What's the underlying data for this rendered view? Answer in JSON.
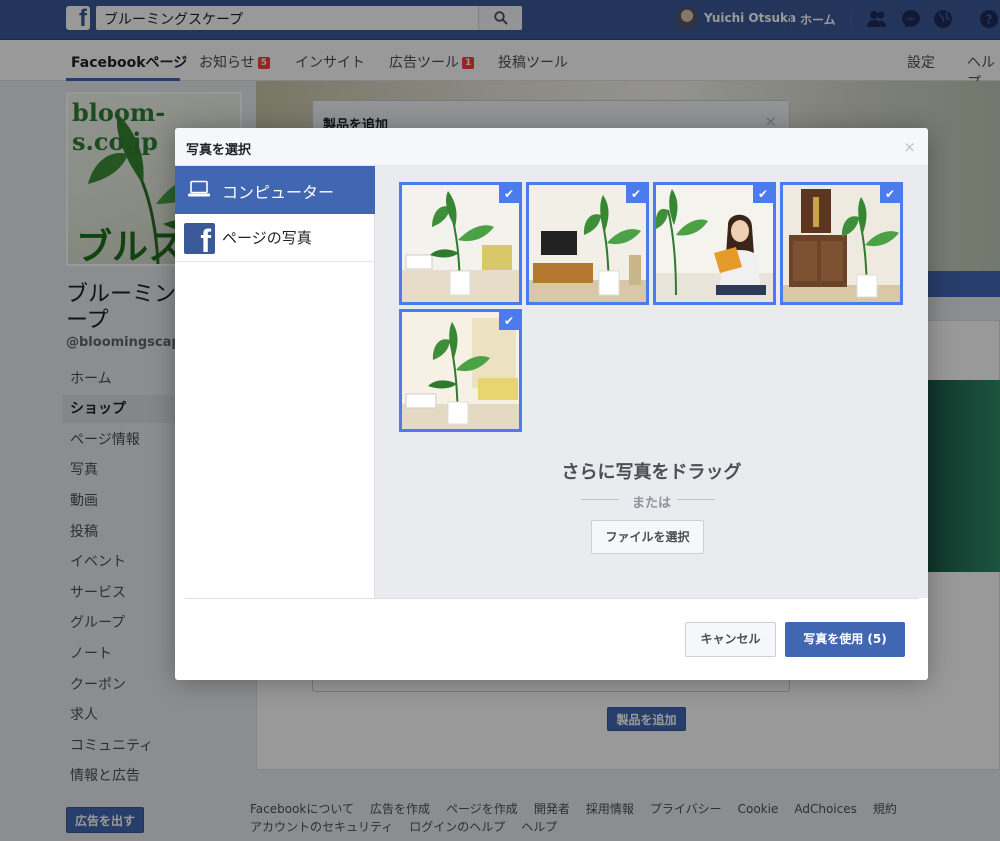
{
  "topbar": {
    "search_value": "ブルーミングスケープ",
    "user_name": "Yuichi Otsuka",
    "home_label": "ホーム"
  },
  "page_tabs": [
    {
      "label": "Facebookページ",
      "badge": ""
    },
    {
      "label": "お知らせ",
      "badge": "5"
    },
    {
      "label": "インサイト",
      "badge": ""
    },
    {
      "label": "広告ツール",
      "badge": "1"
    },
    {
      "label": "投稿ツール",
      "badge": ""
    },
    {
      "label": "設定",
      "badge": ""
    },
    {
      "label": "ヘルプ",
      "badge": ""
    }
  ],
  "left": {
    "profile_brand": "bloom-s.co.jp",
    "profile_jp": "ブルス",
    "page_name": "ブルーミングスケープ",
    "handle": "@bloomingscape",
    "nav": [
      "ホーム",
      "ショップ",
      "ページ情報",
      "写真",
      "動画",
      "投稿",
      "イベント",
      "サービス",
      "グループ",
      "ノート",
      "クーポン",
      "求人",
      "コミュニティ",
      "情報と広告"
    ],
    "active_nav": "ショップ",
    "ad_button": "広告を出す"
  },
  "product_dialog": {
    "title": "製品を追加",
    "add_button": "製品を追加"
  },
  "footer": {
    "links": [
      "Facebookについて",
      "広告を作成",
      "ページを作成",
      "開発者",
      "採用情報",
      "プライバシー",
      "Cookie",
      "AdChoices",
      "規約",
      "アカウントのセキュリティ",
      "ログインのヘルプ",
      "ヘルプ"
    ]
  },
  "dialog": {
    "title": "写真を選択",
    "close": "×",
    "sidebar": [
      {
        "label": "コンピューター",
        "icon": "laptop-icon"
      },
      {
        "label": "ページの写真",
        "icon": "facebook-icon"
      }
    ],
    "photos": [
      {
        "selected": true,
        "subject": "plant-living-room"
      },
      {
        "selected": true,
        "subject": "plant-tv-room"
      },
      {
        "selected": true,
        "subject": "woman-reading"
      },
      {
        "selected": true,
        "subject": "plant-cabinet"
      },
      {
        "selected": true,
        "subject": "plant-sofa"
      }
    ],
    "check_glyph": "✔",
    "drag_title": "さらに写真をドラッグ",
    "or_text": "または",
    "file_button": "ファイルを選択",
    "cancel_button": "キャンセル",
    "use_button": "写真を使用 (5)"
  },
  "colors": {
    "fb_blue": "#3b5998",
    "button_blue": "#4267b2",
    "selection_blue": "#4b7bec",
    "badge_red": "#fa3e3e"
  }
}
